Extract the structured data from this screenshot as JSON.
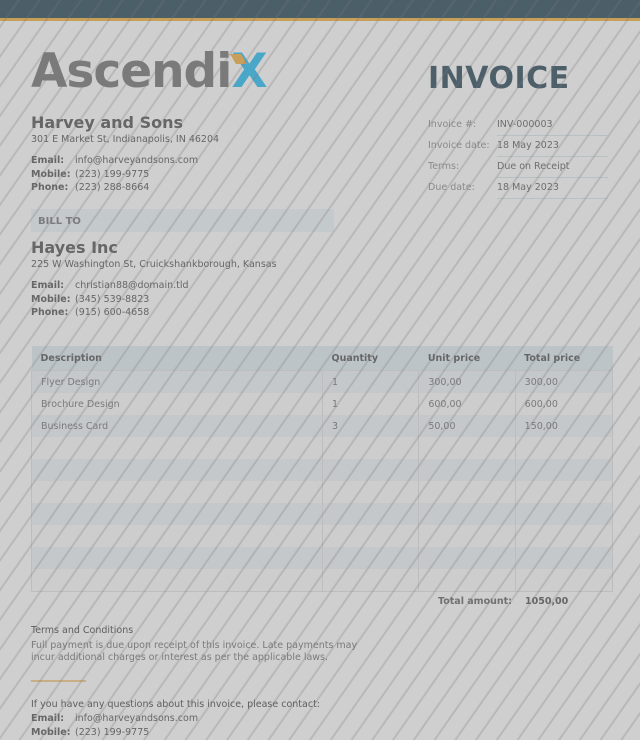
{
  "brand": {
    "logo_main": "Ascendi",
    "logo_x": "X",
    "accent": "#c99e58",
    "header_color": "#4b5f69",
    "logo_x_color": "#4aa7c8"
  },
  "seller": {
    "name": "Harvey and Sons",
    "address": "301 E Market St, Indianapolis, IN 46204",
    "contacts": [
      {
        "label": "Email:",
        "value": "info@harveyandsons.com"
      },
      {
        "label": "Mobile:",
        "value": "(223) 199-9775"
      },
      {
        "label": "Phone:",
        "value": "(223) 288-8664"
      }
    ]
  },
  "invoice": {
    "title": "INVOICE",
    "meta": [
      {
        "label": "Invoice #:",
        "value": "INV-000003"
      },
      {
        "label": "Invoice date:",
        "value": "18 May 2023"
      },
      {
        "label": "Terms:",
        "value": "Due on Receipt"
      },
      {
        "label": "Due date:",
        "value": "18 May 2023"
      }
    ]
  },
  "bill_to": {
    "heading": "BILL TO",
    "name": "Hayes Inc",
    "address": "225 W Washington St, Cruickshankborough, Kansas",
    "contacts": [
      {
        "label": "Email:",
        "value": "christian88@domain.tld"
      },
      {
        "label": "Mobile:",
        "value": "(345) 539-8823"
      },
      {
        "label": "Phone:",
        "value": "(915) 600-4658"
      }
    ]
  },
  "table": {
    "headers": [
      "Description",
      "Quantity",
      "Unit price",
      "Total price"
    ],
    "rows": [
      [
        "Flyer Design",
        "1",
        "300,00",
        "300,00"
      ],
      [
        "Brochure Design",
        "1",
        "600,00",
        "600,00"
      ],
      [
        "Business Card",
        "3",
        "50,00",
        "150,00"
      ],
      [
        "",
        "",
        "",
        ""
      ],
      [
        "",
        "",
        "",
        ""
      ],
      [
        "",
        "",
        "",
        ""
      ],
      [
        "",
        "",
        "",
        ""
      ],
      [
        "",
        "",
        "",
        ""
      ],
      [
        "",
        "",
        "",
        ""
      ],
      [
        "",
        "",
        "",
        ""
      ]
    ],
    "total_label": "Total amount:",
    "total_value": "1050,00"
  },
  "terms": {
    "title": "Terms and Conditions",
    "text": "Full payment is due upon receipt of this invoice. Late payments may incur additional charges or interest as per the applicable laws."
  },
  "footer_contact": {
    "question": "If you have any questions about this invoice, please contact:",
    "contacts": [
      {
        "label": "Email:",
        "value": "info@harveyandsons.com"
      },
      {
        "label": "Mobile:",
        "value": "(223) 199-9775"
      }
    ]
  }
}
